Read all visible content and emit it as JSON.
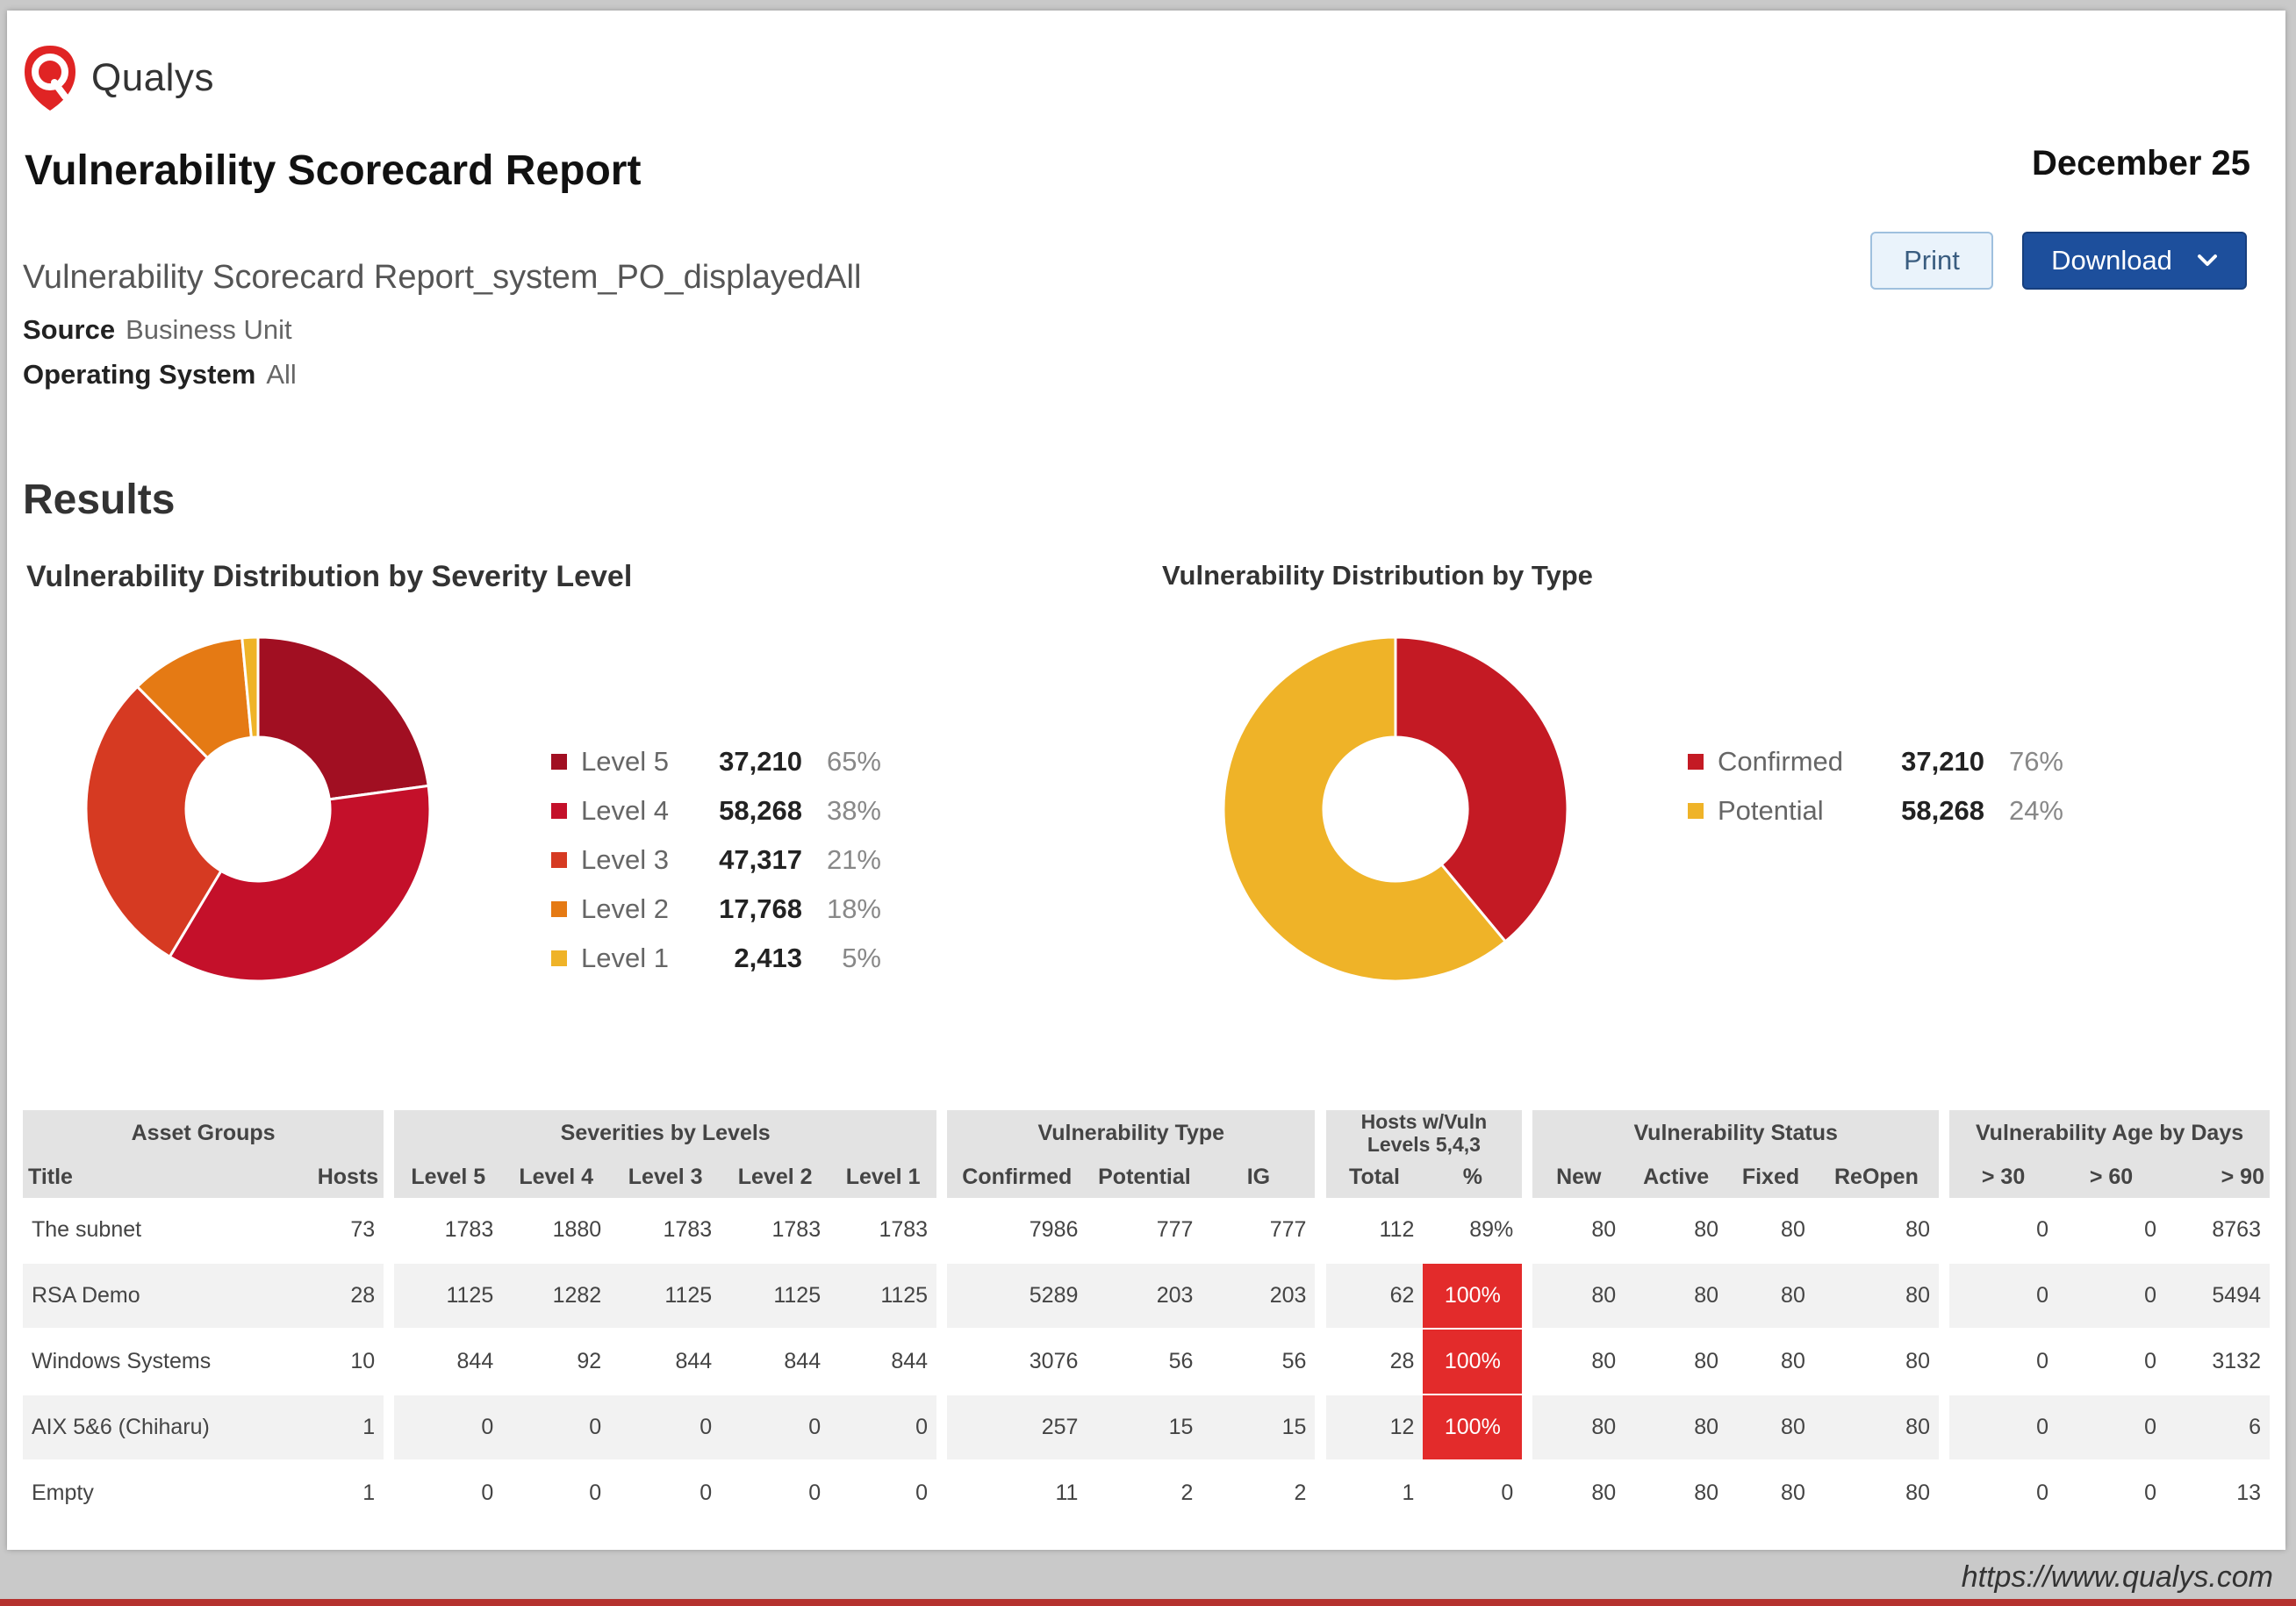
{
  "brand": {
    "name": "Qualys"
  },
  "header": {
    "title": "Vulnerability Scorecard Report",
    "date": "December 25",
    "report_name": "Vulnerability Scorecard Report_system_PO_displayedAll",
    "source_label": "Source",
    "source_value": "Business Unit",
    "os_label": "Operating System",
    "os_value": "All"
  },
  "toolbar": {
    "print_label": "Print",
    "download_label": "Download"
  },
  "results": {
    "heading": "Results",
    "severity_chart_title": "Vulnerability Distribution by Severity Level",
    "type_chart_title": "Vulnerability Distribution by Type"
  },
  "chart_data": [
    {
      "type": "pie",
      "title": "Vulnerability Distribution by Severity Level",
      "categories": [
        "Level 5",
        "Level 4",
        "Level 3",
        "Level 2",
        "Level 1"
      ],
      "values": [
        37210,
        58268,
        47317,
        17768,
        2413
      ],
      "counts_label": [
        "37,210",
        "58,268",
        "47,317",
        "17,768",
        "2,413"
      ],
      "percents_label": [
        "65%",
        "38%",
        "21%",
        "18%",
        "5%"
      ],
      "colors": [
        "#a10f22",
        "#c4102a",
        "#d63a22",
        "#e57a14",
        "#efb328"
      ],
      "legend": "right"
    },
    {
      "type": "pie",
      "title": "Vulnerability Distribution by Type",
      "categories": [
        "Confirmed",
        "Potential"
      ],
      "values": [
        37210,
        58268
      ],
      "counts_label": [
        "37,210",
        "58,268"
      ],
      "percents_label": [
        "76%",
        "24%"
      ],
      "colors": [
        "#c41a24",
        "#efb328"
      ],
      "legend": "right"
    }
  ],
  "table": {
    "groups": {
      "asset_groups": "Asset Groups",
      "severities": "Severities by Levels",
      "vuln_type": "Vulnerability Type",
      "hosts_vuln": "Hosts w/Vuln Levels 5,4,3",
      "vuln_status": "Vulnerability Status",
      "vuln_age": "Vulnerability Age by Days"
    },
    "columns": [
      "Title",
      "Hosts",
      "Level 5",
      "Level 4",
      "Level 3",
      "Level 2",
      "Level 1",
      "Confirmed",
      "Potential",
      "IG",
      "Total",
      "%",
      "New",
      "Active",
      "Fixed",
      "ReOpen",
      "> 30",
      "> 60",
      "> 90"
    ],
    "rows": [
      [
        "The subnet",
        "73",
        "1783",
        "1880",
        "1783",
        "1783",
        "1783",
        "7986",
        "777",
        "777",
        "112",
        "89%",
        "80",
        "80",
        "80",
        "80",
        "0",
        "0",
        "8763"
      ],
      [
        "RSA Demo",
        "28",
        "1125",
        "1282",
        "1125",
        "1125",
        "1125",
        "5289",
        "203",
        "203",
        "62",
        "100%",
        "80",
        "80",
        "80",
        "80",
        "0",
        "0",
        "5494"
      ],
      [
        "Windows Systems",
        "10",
        "844",
        "92",
        "844",
        "844",
        "844",
        "3076",
        "56",
        "56",
        "28",
        "100%",
        "80",
        "80",
        "80",
        "80",
        "0",
        "0",
        "3132"
      ],
      [
        "AIX 5&6 (Chiharu)",
        "1",
        "0",
        "0",
        "0",
        "0",
        "0",
        "257",
        "15",
        "15",
        "12",
        "100%",
        "80",
        "80",
        "80",
        "80",
        "0",
        "0",
        "6"
      ],
      [
        "Empty",
        "1",
        "0",
        "0",
        "0",
        "0",
        "0",
        "11",
        "2",
        "2",
        "1",
        "0",
        "80",
        "80",
        "80",
        "80",
        "0",
        "0",
        "13"
      ]
    ],
    "alert_color": "#e32b2b"
  },
  "footer": {
    "source_url": "https://www.qualys.com"
  }
}
